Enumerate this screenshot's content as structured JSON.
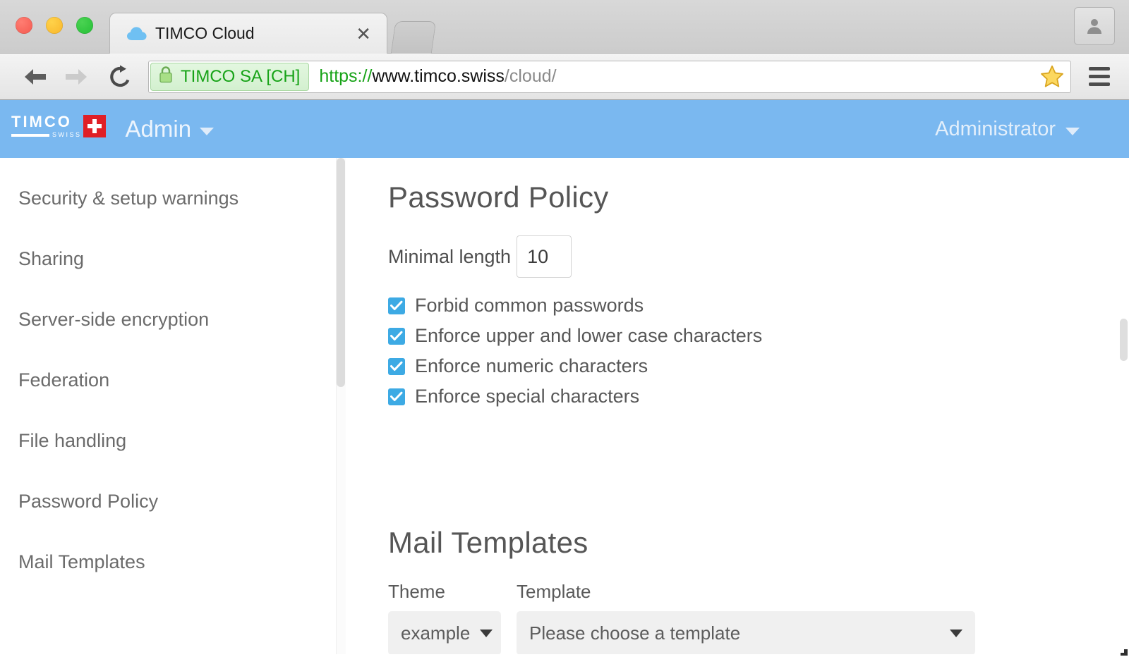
{
  "browser": {
    "tab": {
      "title": "TIMCO Cloud",
      "favicon_icon": "cloud-icon",
      "close_icon": "close-icon"
    },
    "newtab_icon": "new-tab-button",
    "profile_icon": "person-icon",
    "nav": {
      "back_icon": "back-arrow-icon",
      "forward_icon": "forward-arrow-icon",
      "reload_icon": "reload-icon"
    },
    "omnibox": {
      "lock_icon": "lock-icon",
      "ev_label": "TIMCO SA [CH]",
      "url_scheme": "https://",
      "url_host": "www.timco.swiss",
      "url_path": "/cloud/",
      "star_icon": "star-icon"
    },
    "menu_icon": "hamburger-menu-icon",
    "window_controls": [
      "close",
      "minimize",
      "maximize"
    ]
  },
  "app": {
    "header": {
      "logo_word": "TIMCO",
      "logo_sub": "SWISS",
      "menu_label": "Admin",
      "menu_caret_icon": "chevron-down-icon",
      "user_label": "Administrator",
      "user_caret_icon": "chevron-down-icon",
      "bg_color": "#7ab8f0"
    },
    "sidebar": {
      "items": [
        {
          "label": "Security & setup warnings"
        },
        {
          "label": "Sharing"
        },
        {
          "label": "Server-side encryption"
        },
        {
          "label": "Federation"
        },
        {
          "label": "File handling"
        },
        {
          "label": "Password Policy"
        },
        {
          "label": "Mail Templates"
        }
      ]
    },
    "password_policy": {
      "title": "Password Policy",
      "minimal_length_label": "Minimal length",
      "minimal_length_value": "10",
      "checkboxes": [
        {
          "label": "Forbid common passwords",
          "checked": true
        },
        {
          "label": "Enforce upper and lower case characters",
          "checked": true
        },
        {
          "label": "Enforce numeric characters",
          "checked": true
        },
        {
          "label": "Enforce special characters",
          "checked": true
        }
      ],
      "checkbox_color": "#3daae4"
    },
    "mail_templates": {
      "title": "Mail Templates",
      "theme_label": "Theme",
      "theme_value": "example",
      "template_label": "Template",
      "template_value": "Please choose a template",
      "caret_icon": "caret-down-icon"
    }
  }
}
